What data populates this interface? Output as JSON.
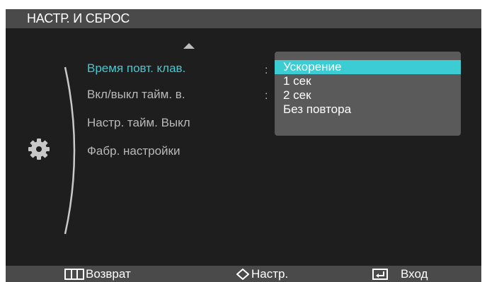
{
  "title": "НАСТР. И СБРОС",
  "menu": {
    "items": [
      {
        "label": "Время повт. клав.",
        "active": true
      },
      {
        "label": "Вкл/выкл тайм. в.",
        "active": false
      },
      {
        "label": "Настр. тайм. Выкл",
        "active": false
      },
      {
        "label": "Фабр. настройки",
        "active": false
      }
    ],
    "scroll_up_icon": "triangle-up-icon",
    "category_icon": "gear-icon"
  },
  "submenu": {
    "colons": [
      ":",
      ":"
    ],
    "options": [
      "Ускорение",
      "1 сек",
      "2 сек",
      "Без повтора"
    ],
    "selected": "Ускорение"
  },
  "footer": {
    "back": {
      "label": "Возврат",
      "icon": "menu-bars-icon"
    },
    "adjust": {
      "label": "Настр.",
      "icon": "diamond-arrows-icon"
    },
    "enter": {
      "label": "Вход",
      "icon": "enter-return-icon"
    }
  },
  "colors": {
    "accent": "#3fcad3",
    "selection": "#3ccdd4",
    "background": "#1e1e1e",
    "bar": "#4a4a4a",
    "popup": "#5a5a5a"
  }
}
